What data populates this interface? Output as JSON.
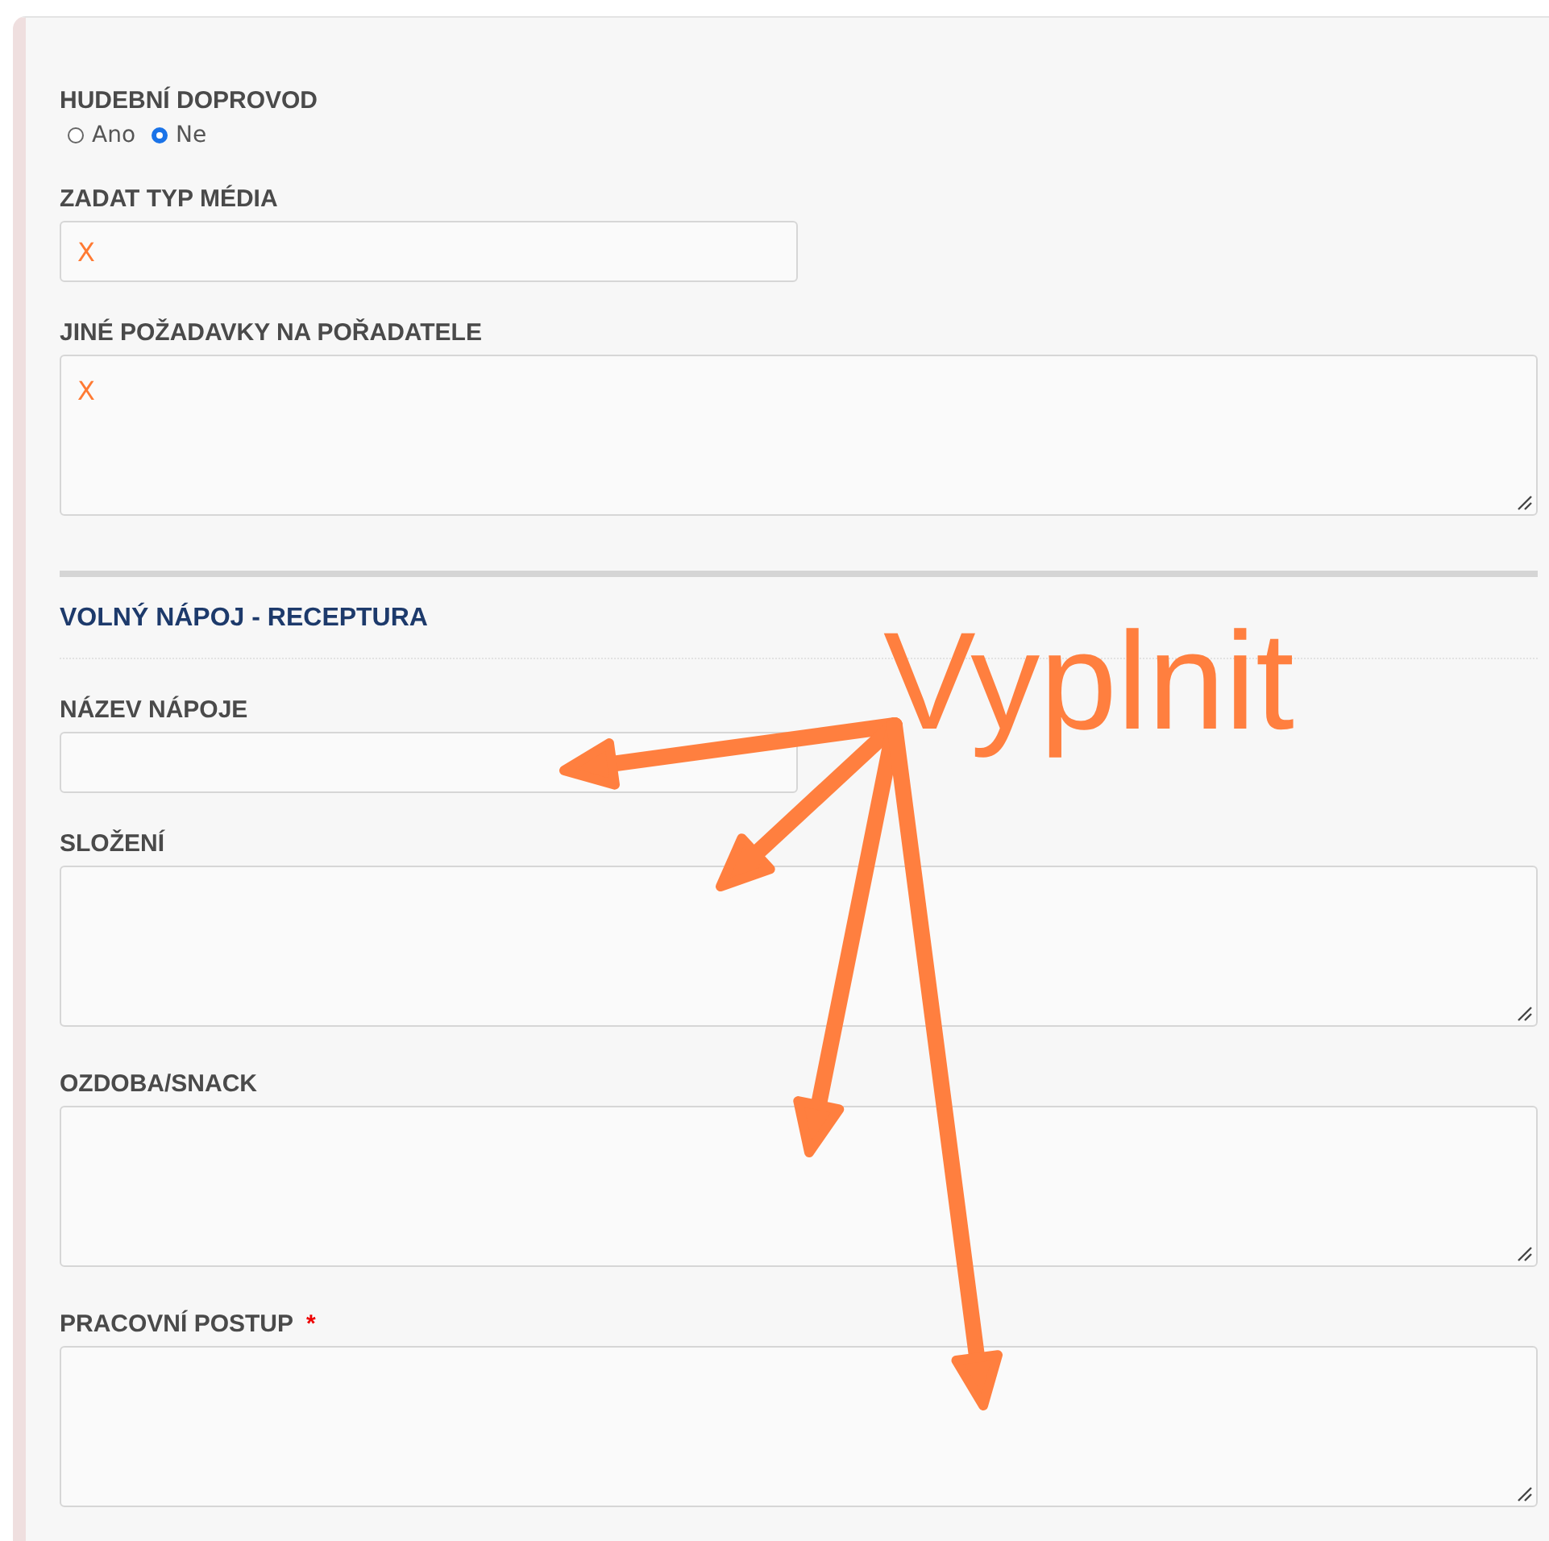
{
  "fields_top": [
    {
      "kind": "radio",
      "label": "HUDEBNÍ DOPROVOD",
      "options": [
        {
          "label": "Ano",
          "selected": false
        },
        {
          "label": "Ne",
          "selected": true
        }
      ]
    },
    {
      "kind": "input",
      "label": "ZADAT TYP MÉDIA",
      "value": "X"
    },
    {
      "kind": "textarea",
      "label": "JINÉ POŽADAVKY NA POŘADATELE",
      "value": "X"
    }
  ],
  "section": {
    "title": "VOLNÝ NÁPOJ - RECEPTURA",
    "fields": [
      {
        "kind": "input",
        "label": "NÁZEV NÁPOJE"
      },
      {
        "kind": "textarea",
        "label": "SLOŽENÍ"
      },
      {
        "kind": "textarea",
        "label": "OZDOBA/SNACK"
      },
      {
        "kind": "textarea",
        "label": "PRACOVNÍ POSTUP",
        "required_mark": "*"
      }
    ]
  },
  "annotation": {
    "text": "Vyplnit"
  }
}
